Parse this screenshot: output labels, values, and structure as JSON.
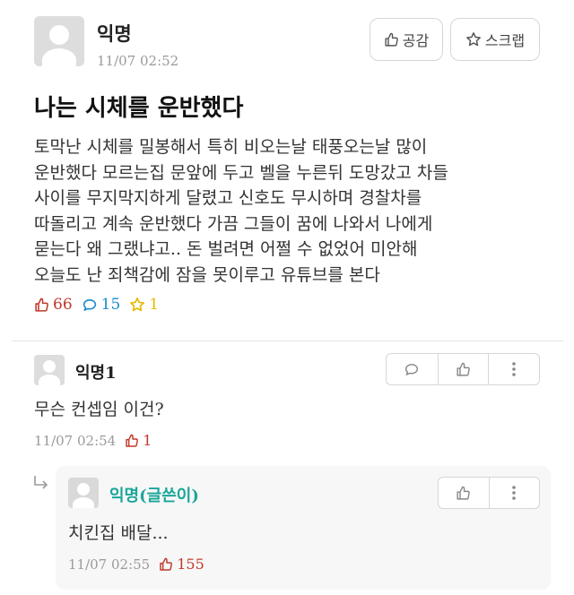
{
  "post": {
    "author": "익명",
    "timestamp": "11/07 02:52",
    "empathy_label": "공감",
    "scrap_label": "스크랩",
    "title": "나는 시체를 운반했다",
    "body_lines": [
      "토막난 시체를 밀봉해서 특히 비오는날 태풍오는날 많이",
      "운반했다 모르는집 문앞에 두고 벨을 누른뒤 도망갔고 차들",
      "사이를 무지막지하게 달렸고 신호도 무시하며 경찰차를",
      "따돌리고 계속 운반했다 가끔 그들이 꿈에 나와서 나에게",
      "묻는다 왜 그랬냐고.. 돈 벌려면 어쩔 수 없었어 미안해",
      "오늘도 난 죄책감에 잠을 못이루고 유튜브를 본다"
    ],
    "likes": "66",
    "comments": "15",
    "scraps": "1"
  },
  "comments": [
    {
      "author": "익명1",
      "text": "무슨 컨셉임 이건?",
      "timestamp": "11/07 02:54",
      "likes": "1"
    }
  ],
  "reply": {
    "author": "익명(글쓴이)",
    "text": "치킨집 배달...",
    "timestamp": "11/07 02:55",
    "likes": "155"
  },
  "colors": {
    "like": "#c0392b",
    "comment": "#1a8ccf",
    "scrap": "#e6b800",
    "writer": "#1aa69a",
    "muted": "#9a9a9a"
  }
}
